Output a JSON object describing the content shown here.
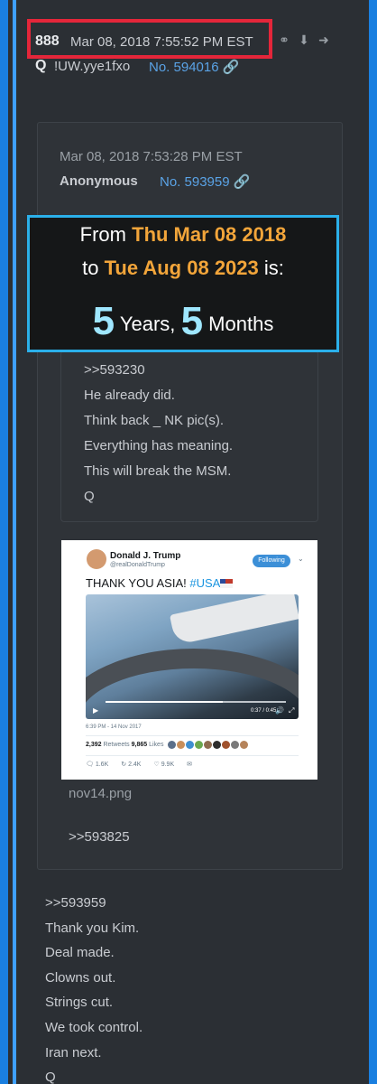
{
  "header": {
    "post_number": "888",
    "date": "Mar 08, 2018 7:55:52 PM EST",
    "author": "Q",
    "tripcode": "!UW.yye1fxo",
    "post_link": "No. 594016",
    "icons": [
      "share-icon",
      "download-icon",
      "arrow-right-circle-icon"
    ]
  },
  "quoted_post": {
    "date": "Mar 08, 2018 7:53:28 PM EST",
    "author": "Anonymous",
    "post_link": "No. 593959",
    "nested_lines": [
      ">>593230",
      "He already did.",
      "Think back _ NK pic(s).",
      "Everything has meaning.",
      "This will break the MSM.",
      "Q"
    ],
    "attachment": {
      "filename": "nov14.png",
      "tweet": {
        "name": "Donald J. Trump",
        "handle": "@realDonaldTrump",
        "follow_label": "Following",
        "text_prefix": "THANK YOU ASIA! ",
        "hashtag": "#USA",
        "video_time": "0:37 / 0:45",
        "timestamp": "6:39 PM - 14 Nov 2017",
        "retweets_count": "2,392",
        "retweets_label": "Retweets",
        "likes_count": "9,865",
        "likes_label": "Likes",
        "replies": "1.6K",
        "rt_action": "2.4K",
        "like_action": "9.9K"
      }
    },
    "reply_ref": ">>593825"
  },
  "overlay": {
    "from_label": "From",
    "from_date": "Thu Mar 08 2018",
    "to_label": "to",
    "to_date": "Tue Aug 08 2023",
    "is_label": "is:",
    "years_num": "5",
    "years_label": "Years,",
    "months_num": "5",
    "months_label": "Months"
  },
  "body_lines": [
    ">>593959",
    "Thank you Kim.",
    "Deal made.",
    "Clowns out.",
    "Strings cut.",
    "We took control.",
    "Iran next.",
    "Q"
  ],
  "colors": {
    "background_border": "#1a7fe0",
    "panel": "#2b2f34",
    "highlight_box": "#e4263a",
    "overlay_border": "#2bb0ea",
    "overlay_accent": "#f2a53a",
    "overlay_number": "#9fe7ff",
    "link": "#5aa3e6"
  }
}
